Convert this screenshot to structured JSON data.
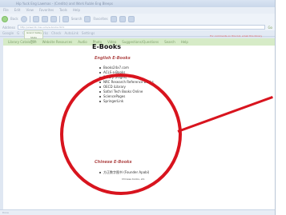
{
  "window": {
    "title": "Hip Yuck Eng Lawmas - (Credits) and Work Ruble Eng Bleeps"
  },
  "menu": [
    "File",
    "Edit",
    "View",
    "Favorites",
    "Tools",
    "Help"
  ],
  "toolbar": {
    "back_label": "Back",
    "search_label": "Search",
    "favorites_label": "Favorites"
  },
  "addressbar": {
    "label": "Address",
    "url": "http://www.lib.msu.edu/e-books.html",
    "go_label": "Go"
  },
  "linksbar": [
    "Google",
    "G",
    "Go",
    "Bookmarks",
    "Check",
    "AutoLink",
    "Settings"
  ],
  "site_nav": [
    "Library Catalogue",
    "Website Resources",
    "Audio",
    "Photo",
    "Video",
    "Suggestions/Questions",
    "Search",
    "Help"
  ],
  "logo": {
    "text": "Grand Valley",
    "sub": "State Univ."
  },
  "note": "For comments on this list, email this library",
  "page": {
    "heading": "E-Books",
    "english_section": "English E-Books",
    "english_books": [
      "Books24x7.com",
      "ACLS e-Books",
      "Ebrary (Pages)",
      "NRC Research Reference Books",
      "OECD iLibrary",
      "Safari Tech Books Online",
      "SciencePages",
      "SpringerLink"
    ],
    "chinese_section": "Chinese E-Books",
    "chinese_books": [
      "方正数字图书 (Founder Apabi)"
    ],
    "chinese_note": "Chinese books, etc."
  },
  "status": "Done"
}
